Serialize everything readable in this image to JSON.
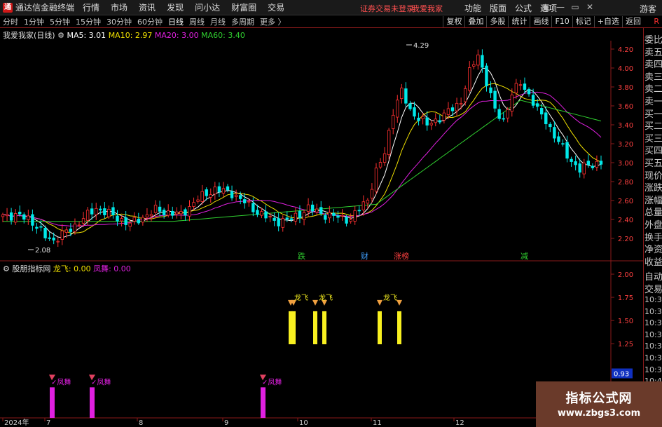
{
  "titlebar": {
    "logo": "通",
    "app_title": "通达信金融终端",
    "menu": [
      "行情",
      "市场",
      "资讯",
      "发现",
      "问小达",
      "财富圈",
      "交易"
    ],
    "login_status": "证券交易未登录",
    "login_user": "我爱我家",
    "right_menu": [
      "功能",
      "版面",
      "公式",
      "选项"
    ],
    "win_controls": [
      "▣",
      "—",
      "▭",
      "✕"
    ],
    "guest": "游客"
  },
  "toolbar": {
    "periods": [
      "分时",
      "1分钟",
      "5分钟",
      "15分钟",
      "30分钟",
      "60分钟",
      "日线",
      "周线",
      "月线",
      "多周期",
      "更多 〉"
    ],
    "active_period": "日线",
    "buttons": [
      "复权",
      "叠加",
      "多股",
      "统计",
      "画线",
      "F10",
      "标记",
      "+自选",
      "返回"
    ],
    "r_badge": "R"
  },
  "main_chart": {
    "stock_name": "我爱我家(日线)",
    "ma": [
      {
        "label": "MA5: 3.01",
        "color": "#ffffff"
      },
      {
        "label": "MA10: 2.97",
        "color": "#f0e000"
      },
      {
        "label": "MA20: 3.00",
        "color": "#e020e0"
      },
      {
        "label": "MA60: 3.40",
        "color": "#30d030"
      }
    ],
    "high_label": "4.29",
    "low_label": "2.08",
    "price_ticks": [
      "4.20",
      "4.00",
      "3.80",
      "3.60",
      "3.40",
      "3.20",
      "3.00",
      "2.80",
      "2.60",
      "2.40",
      "2.20"
    ],
    "tags": [
      {
        "text": "跌",
        "color": "#30d030"
      },
      {
        "text": "财",
        "color": "#40a0ff"
      },
      {
        "text": "涨榜",
        "color": "#ff4040"
      },
      {
        "text": "减",
        "color": "#30d030"
      }
    ]
  },
  "indicator": {
    "name": "股朋指标网",
    "long_label": "龙飞: 0.00",
    "feng_label": "凤舞: 0.00",
    "ticks": [
      "2.00",
      "1.75",
      "1.50",
      "1.25",
      "0.93",
      "0.75",
      "0.50"
    ],
    "long_signal_label": "龙飞",
    "feng_signal_label": "✓凤舞"
  },
  "x_axis": {
    "labels": [
      "2024年",
      "7",
      "8",
      "9",
      "10",
      "11",
      "12"
    ]
  },
  "right_panel": {
    "items": [
      "委比",
      "卖五",
      "卖四",
      "卖三",
      "卖二",
      "卖一",
      "买一",
      "买二",
      "买三",
      "买四",
      "买五",
      "现价",
      "涨跌",
      "涨幅",
      "总量",
      "外盘",
      "换手",
      "净资",
      "收益"
    ],
    "items2": [
      "自动",
      "交易"
    ],
    "times": [
      "10:39",
      "10:39",
      "10:39",
      "10:39",
      "10:39",
      "10:39",
      "10:39",
      "10:40",
      "10:40"
    ]
  },
  "watermark": {
    "line1": "指标公式网",
    "line2": "www.zbgs3.com"
  },
  "colors": {
    "bg": "#000000",
    "up": "#ff3030",
    "down": "#00e8e8",
    "ma5": "#ffffff",
    "ma10": "#f0e000",
    "ma20": "#e020e0",
    "ma60": "#30d030",
    "grid": "#8a1a1a"
  },
  "chart_data": {
    "type": "candlestick",
    "y_range": [
      2.08,
      4.29
    ],
    "x_months": [
      "2024年",
      "7",
      "8",
      "9",
      "10",
      "11",
      "12"
    ],
    "ma_last": {
      "MA5": 3.01,
      "MA10": 2.97,
      "MA20": 3.0,
      "MA60": 3.4
    },
    "indicator_range": [
      0.5,
      2.0
    ],
    "series": [
      {
        "name": "MA5",
        "color": "#ffffff"
      },
      {
        "name": "MA10",
        "color": "#f0e000"
      },
      {
        "name": "MA20",
        "color": "#e020e0"
      },
      {
        "name": "MA60",
        "color": "#30d030"
      }
    ]
  }
}
